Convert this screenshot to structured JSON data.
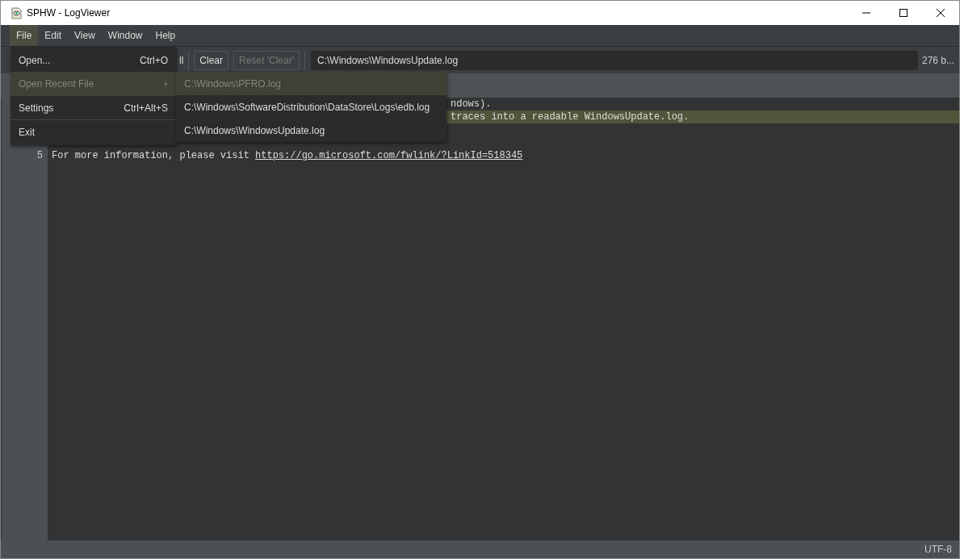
{
  "window": {
    "title": "SPHW - LogViewer"
  },
  "menu_bar": [
    {
      "label": "File",
      "selected": true
    },
    {
      "label": "Edit",
      "selected": false
    },
    {
      "label": "View",
      "selected": false
    },
    {
      "label": "Window",
      "selected": false
    },
    {
      "label": "Help",
      "selected": false
    }
  ],
  "toolbar": {
    "buttons": [
      {
        "label": "ll",
        "disabled": false
      },
      {
        "label": "Clear",
        "disabled": false
      },
      {
        "label": "Reset 'Clear'",
        "disabled": true
      }
    ],
    "path": "C:\\Windows\\WindowsUpdate.log",
    "size": "276 b..."
  },
  "editor": {
    "lines": [
      {
        "kind": "partial",
        "text": "ndows).",
        "highlighted": false
      },
      {
        "kind": "partial",
        "text": "traces into a readable WindowsUpdate.log.",
        "highlighted": true
      },
      {
        "kind": "empty",
        "highlighted": false
      },
      {
        "kind": "empty",
        "highlighted": false
      },
      {
        "kind": "full",
        "number": "5",
        "text": "For more information, please visit ",
        "link": "https://go.microsoft.com/fwlink/?LinkId=518345",
        "highlighted": false
      }
    ]
  },
  "file_menu": [
    {
      "kind": "item",
      "label": "Open...",
      "shortcut": "Ctrl+O",
      "disabled": false,
      "selected": false
    },
    {
      "kind": "submenu",
      "label": "Open Recent File",
      "disabled": true,
      "selected": true
    },
    {
      "kind": "separator"
    },
    {
      "kind": "item",
      "label": "Settings",
      "shortcut": "Ctrl+Alt+S",
      "disabled": false,
      "selected": false
    },
    {
      "kind": "separator"
    },
    {
      "kind": "item",
      "label": "Exit",
      "disabled": false,
      "selected": false
    }
  ],
  "recent_files": [
    {
      "label": "C:\\Windows\\PFRO.log",
      "disabled": true,
      "selected": true
    },
    {
      "label": "C:\\Windows\\SoftwareDistribution\\DataStore\\Logs\\edb.log",
      "disabled": false,
      "selected": false
    },
    {
      "label": "C:\\Windows\\WindowsUpdate.log",
      "disabled": false,
      "selected": false
    }
  ],
  "status_bar": {
    "encoding": "UTF-8"
  }
}
